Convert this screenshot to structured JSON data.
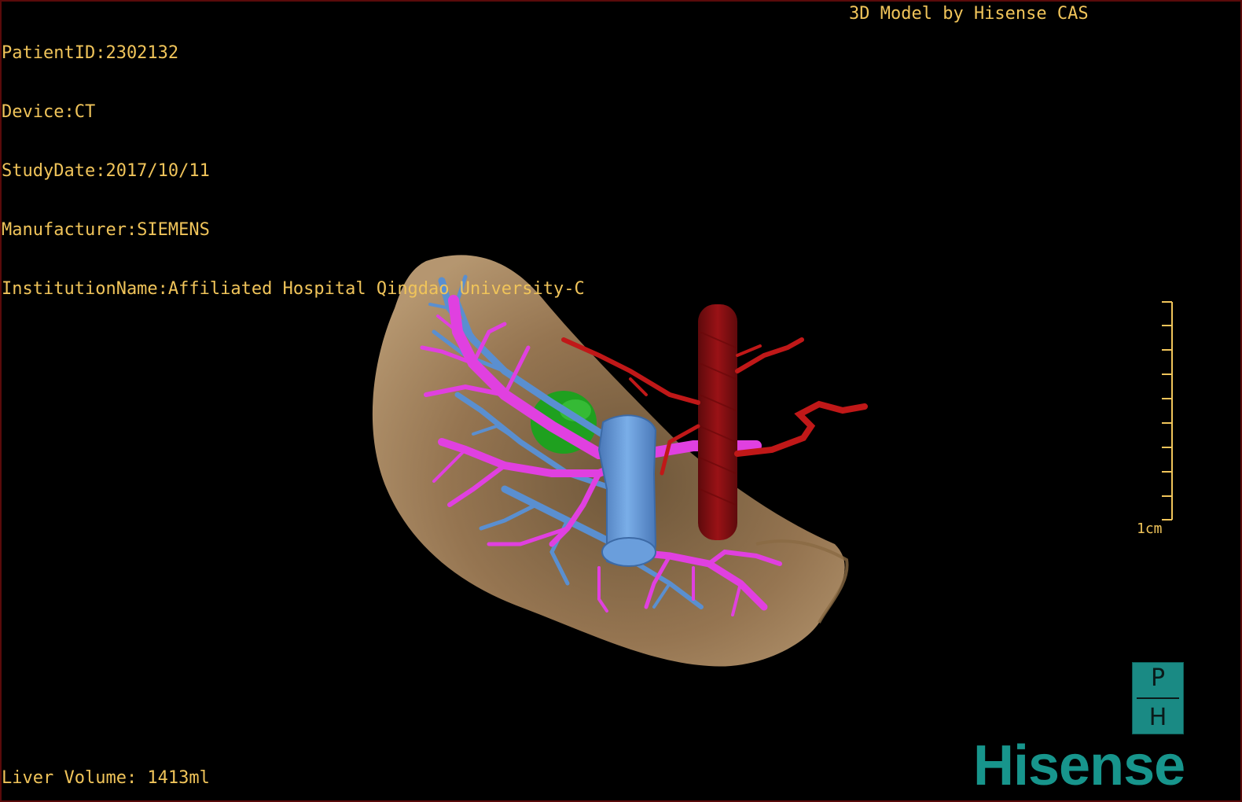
{
  "overlay": {
    "patient_id": "PatientID:2302132",
    "device": "Device:CT",
    "study_date": "StudyDate:2017/10/11",
    "manufacturer": "Manufacturer:SIEMENS",
    "institution": "InstitutionName:Affiliated Hospital Qingdao University-C",
    "model_credit": "3D Model by Hisense CAS",
    "liver_volume": "Liver Volume: 1413ml"
  },
  "scale": {
    "label": "1cm"
  },
  "logo": {
    "ph_top": "P",
    "ph_bottom": "H",
    "brand": "Hisense"
  },
  "colors": {
    "overlay_text": "#f0c45a",
    "liver": "#b08a5c",
    "portal_vein": "#e040e0",
    "hepatic_vein": "#5a8fd0",
    "artery": "#c01818",
    "ivc": "#8a0e12",
    "tumor": "#1fa01f",
    "brand": "#17958c"
  }
}
